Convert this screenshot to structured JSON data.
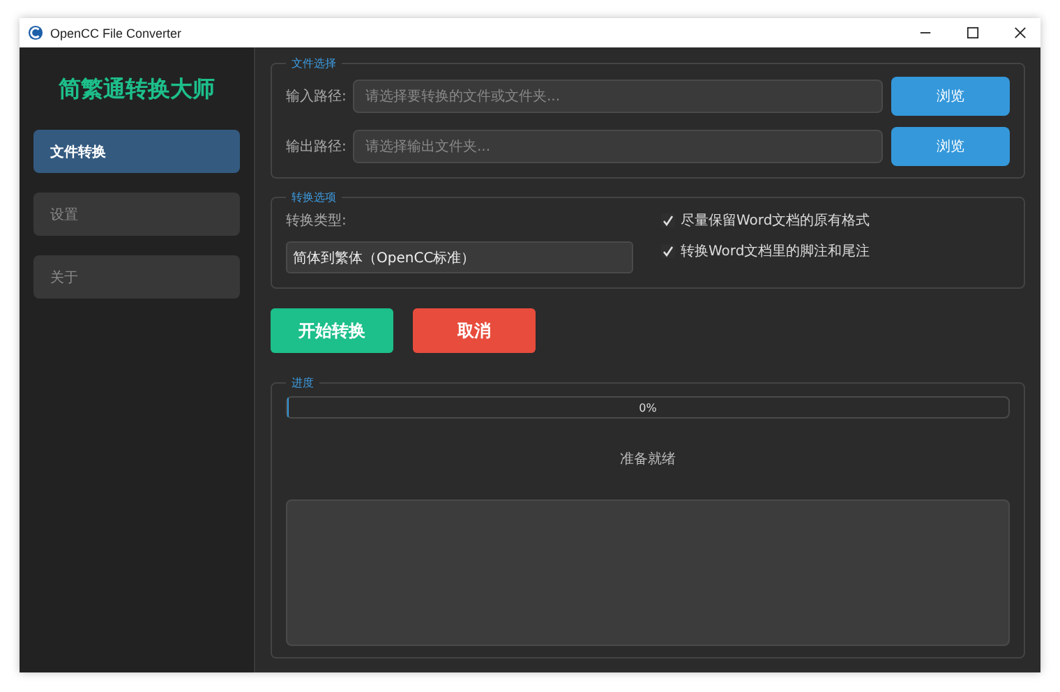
{
  "window": {
    "title": "OpenCC File Converter"
  },
  "sidebar": {
    "title": "简繁通转换大师",
    "items": [
      {
        "label": "文件转换",
        "selected": true
      },
      {
        "label": "设置",
        "selected": false
      },
      {
        "label": "关于",
        "selected": false
      }
    ]
  },
  "file_selection": {
    "title": "文件选择",
    "rows": [
      {
        "label": "输入路径:",
        "placeholder": "请选择要转换的文件或文件夹...",
        "button": "浏览"
      },
      {
        "label": "输出路径:",
        "placeholder": "请选择输出文件夹...",
        "button": "浏览"
      }
    ]
  },
  "options": {
    "title": "转换选项",
    "type_label": "转换类型:",
    "type_value": "简体到繁体（OpenCC标准）",
    "checkboxes": [
      {
        "label": "尽量保留Word文档的原有格式",
        "checked": true
      },
      {
        "label": "转换Word文档里的脚注和尾注",
        "checked": true
      }
    ]
  },
  "actions": {
    "start": "开始转换",
    "cancel": "取消"
  },
  "progress": {
    "title": "进度",
    "level": 0,
    "reading": "0%",
    "status": "准备就绪"
  }
}
